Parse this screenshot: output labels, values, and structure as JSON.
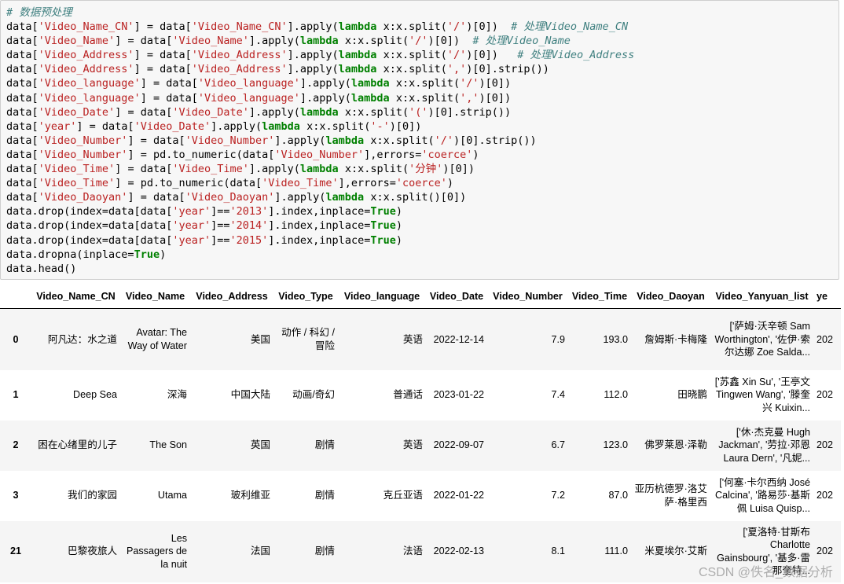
{
  "code_cell": {
    "lines": [
      [
        {
          "t": "# 数据预处理",
          "c": "cm"
        }
      ],
      [
        {
          "t": "data["
        },
        {
          "t": "'Video_Name_CN'",
          "c": "st"
        },
        {
          "t": "] = data["
        },
        {
          "t": "'Video_Name_CN'",
          "c": "st"
        },
        {
          "t": "].apply("
        },
        {
          "t": "lambda",
          "c": "kw"
        },
        {
          "t": " x:x.split("
        },
        {
          "t": "'/'",
          "c": "st"
        },
        {
          "t": ")[0])  "
        },
        {
          "t": "# 处理Video_Name_CN",
          "c": "cm"
        }
      ],
      [
        {
          "t": "data["
        },
        {
          "t": "'Video_Name'",
          "c": "st"
        },
        {
          "t": "] = data["
        },
        {
          "t": "'Video_Name'",
          "c": "st"
        },
        {
          "t": "].apply("
        },
        {
          "t": "lambda",
          "c": "kw"
        },
        {
          "t": " x:x.split("
        },
        {
          "t": "'/'",
          "c": "st"
        },
        {
          "t": ")[0])  "
        },
        {
          "t": "# 处理Video_Name",
          "c": "cm"
        }
      ],
      [
        {
          "t": "data["
        },
        {
          "t": "'Video_Address'",
          "c": "st"
        },
        {
          "t": "] = data["
        },
        {
          "t": "'Video_Address'",
          "c": "st"
        },
        {
          "t": "].apply("
        },
        {
          "t": "lambda",
          "c": "kw"
        },
        {
          "t": " x:x.split("
        },
        {
          "t": "'/'",
          "c": "st"
        },
        {
          "t": ")[0])   "
        },
        {
          "t": "# 处理Video_Address",
          "c": "cm"
        }
      ],
      [
        {
          "t": "data["
        },
        {
          "t": "'Video_Address'",
          "c": "st"
        },
        {
          "t": "] = data["
        },
        {
          "t": "'Video_Address'",
          "c": "st"
        },
        {
          "t": "].apply("
        },
        {
          "t": "lambda",
          "c": "kw"
        },
        {
          "t": " x:x.split("
        },
        {
          "t": "','",
          "c": "st"
        },
        {
          "t": ")[0].strip())"
        }
      ],
      [
        {
          "t": "data["
        },
        {
          "t": "'Video_language'",
          "c": "st"
        },
        {
          "t": "] = data["
        },
        {
          "t": "'Video_language'",
          "c": "st"
        },
        {
          "t": "].apply("
        },
        {
          "t": "lambda",
          "c": "kw"
        },
        {
          "t": " x:x.split("
        },
        {
          "t": "'/'",
          "c": "st"
        },
        {
          "t": ")[0])"
        }
      ],
      [
        {
          "t": "data["
        },
        {
          "t": "'Video_language'",
          "c": "st"
        },
        {
          "t": "] = data["
        },
        {
          "t": "'Video_language'",
          "c": "st"
        },
        {
          "t": "].apply("
        },
        {
          "t": "lambda",
          "c": "kw"
        },
        {
          "t": " x:x.split("
        },
        {
          "t": "','",
          "c": "st"
        },
        {
          "t": ")[0])"
        }
      ],
      [
        {
          "t": "data["
        },
        {
          "t": "'Video_Date'",
          "c": "st"
        },
        {
          "t": "] = data["
        },
        {
          "t": "'Video_Date'",
          "c": "st"
        },
        {
          "t": "].apply("
        },
        {
          "t": "lambda",
          "c": "kw"
        },
        {
          "t": " x:x.split("
        },
        {
          "t": "'('",
          "c": "st"
        },
        {
          "t": ")[0].strip())"
        }
      ],
      [
        {
          "t": "data["
        },
        {
          "t": "'year'",
          "c": "st"
        },
        {
          "t": "] = data["
        },
        {
          "t": "'Video_Date'",
          "c": "st"
        },
        {
          "t": "].apply("
        },
        {
          "t": "lambda",
          "c": "kw"
        },
        {
          "t": " x:x.split("
        },
        {
          "t": "'-'",
          "c": "st"
        },
        {
          "t": ")[0])"
        }
      ],
      [
        {
          "t": "data["
        },
        {
          "t": "'Video_Number'",
          "c": "st"
        },
        {
          "t": "] = data["
        },
        {
          "t": "'Video_Number'",
          "c": "st"
        },
        {
          "t": "].apply("
        },
        {
          "t": "lambda",
          "c": "kw"
        },
        {
          "t": " x:x.split("
        },
        {
          "t": "'/'",
          "c": "st"
        },
        {
          "t": ")[0].strip())"
        }
      ],
      [
        {
          "t": "data["
        },
        {
          "t": "'Video_Number'",
          "c": "st"
        },
        {
          "t": "] = pd.to_numeric(data["
        },
        {
          "t": "'Video_Number'",
          "c": "st"
        },
        {
          "t": "],errors="
        },
        {
          "t": "'coerce'",
          "c": "st"
        },
        {
          "t": ")"
        }
      ],
      [
        {
          "t": "data["
        },
        {
          "t": "'Video_Time'",
          "c": "st"
        },
        {
          "t": "] = data["
        },
        {
          "t": "'Video_Time'",
          "c": "st"
        },
        {
          "t": "].apply("
        },
        {
          "t": "lambda",
          "c": "kw"
        },
        {
          "t": " x:x.split("
        },
        {
          "t": "'分钟'",
          "c": "st"
        },
        {
          "t": ")[0])"
        }
      ],
      [
        {
          "t": "data["
        },
        {
          "t": "'Video_Time'",
          "c": "st"
        },
        {
          "t": "] = pd.to_numeric(data["
        },
        {
          "t": "'Video_Time'",
          "c": "st"
        },
        {
          "t": "],errors="
        },
        {
          "t": "'coerce'",
          "c": "st"
        },
        {
          "t": ")"
        }
      ],
      [
        {
          "t": "data["
        },
        {
          "t": "'Video_Daoyan'",
          "c": "st"
        },
        {
          "t": "] = data["
        },
        {
          "t": "'Video_Daoyan'",
          "c": "st"
        },
        {
          "t": "].apply("
        },
        {
          "t": "lambda",
          "c": "kw"
        },
        {
          "t": " x:x.split()[0])"
        }
      ],
      [
        {
          "t": "data.drop(index=data[data["
        },
        {
          "t": "'year'",
          "c": "st"
        },
        {
          "t": "]=="
        },
        {
          "t": "'2013'",
          "c": "st"
        },
        {
          "t": "].index,inplace="
        },
        {
          "t": "True",
          "c": "kw"
        },
        {
          "t": ")"
        }
      ],
      [
        {
          "t": "data.drop(index=data[data["
        },
        {
          "t": "'year'",
          "c": "st"
        },
        {
          "t": "]=="
        },
        {
          "t": "'2014'",
          "c": "st"
        },
        {
          "t": "].index,inplace="
        },
        {
          "t": "True",
          "c": "kw"
        },
        {
          "t": ")"
        }
      ],
      [
        {
          "t": "data.drop(index=data[data["
        },
        {
          "t": "'year'",
          "c": "st"
        },
        {
          "t": "]=="
        },
        {
          "t": "'2015'",
          "c": "st"
        },
        {
          "t": "].index,inplace="
        },
        {
          "t": "True",
          "c": "kw"
        },
        {
          "t": ")"
        }
      ],
      [
        {
          "t": "data.dropna(inplace="
        },
        {
          "t": "True",
          "c": "kw"
        },
        {
          "t": ")"
        }
      ],
      [
        {
          "t": "data.head()"
        }
      ]
    ]
  },
  "dataframe": {
    "columns": [
      "",
      "Video_Name_CN",
      "Video_Name",
      "Video_Address",
      "Video_Type",
      "Video_language",
      "Video_Date",
      "Video_Number",
      "Video_Time",
      "Video_Daoyan",
      "Video_Yanyuan_list",
      "ye"
    ],
    "rows": [
      {
        "index": "0",
        "Video_Name_CN": "阿凡达：水之道",
        "Video_Name": "Avatar: The Way of Water",
        "Video_Address": "美国",
        "Video_Type": "动作 / 科幻 / 冒险",
        "Video_language": "英语",
        "Video_Date": "2022-12-14",
        "Video_Number": "7.9",
        "Video_Time": "193.0",
        "Video_Daoyan": "詹姆斯·卡梅隆",
        "Video_Yanyuan_list": "['萨姆·沃辛顿 Sam Worthington', '佐伊·索尔达娜 Zoe Salda...",
        "year": "202"
      },
      {
        "index": "1",
        "Video_Name_CN": "Deep Sea",
        "Video_Name": "深海",
        "Video_Address": "中国大陆",
        "Video_Type": "动画/奇幻",
        "Video_language": "普通话",
        "Video_Date": "2023-01-22",
        "Video_Number": "7.4",
        "Video_Time": "112.0",
        "Video_Daoyan": "田晓鹏",
        "Video_Yanyuan_list": "['苏鑫 Xin Su', '王亭文 Tingwen Wang', '滕奎兴 Kuixin...",
        "year": "202"
      },
      {
        "index": "2",
        "Video_Name_CN": "困在心绪里的儿子",
        "Video_Name": "The Son",
        "Video_Address": "英国",
        "Video_Type": "剧情",
        "Video_language": "英语",
        "Video_Date": "2022-09-07",
        "Video_Number": "6.7",
        "Video_Time": "123.0",
        "Video_Daoyan": "佛罗莱恩·泽勒",
        "Video_Yanyuan_list": "['休·杰克曼 Hugh Jackman', '劳拉·邓恩 Laura Dern', '凡妮...",
        "year": "202"
      },
      {
        "index": "3",
        "Video_Name_CN": "我们的家园",
        "Video_Name": "Utama",
        "Video_Address": "玻利维亚",
        "Video_Type": "剧情",
        "Video_language": "克丘亚语",
        "Video_Date": "2022-01-22",
        "Video_Number": "7.2",
        "Video_Time": "87.0",
        "Video_Daoyan": "亚历杭德罗·洛艾萨·格里西",
        "Video_Yanyuan_list": "['何塞·卡尔西纳 José Calcina', '路易莎·基斯佩 Luisa Quisp...",
        "year": "202"
      },
      {
        "index": "21",
        "Video_Name_CN": "巴黎夜旅人",
        "Video_Name": "Les Passagers de la nuit",
        "Video_Address": "法国",
        "Video_Type": "剧情",
        "Video_language": "法语",
        "Video_Date": "2022-02-13",
        "Video_Number": "8.1",
        "Video_Time": "111.0",
        "Video_Daoyan": "米夏埃尔·艾斯",
        "Video_Yanyuan_list": "['夏洛特·甘斯布 Charlotte Gainsbourg', '基多·雷那奎特...",
        "year": "202"
      }
    ]
  },
  "watermark": "CSDN @佚名_数据分析"
}
